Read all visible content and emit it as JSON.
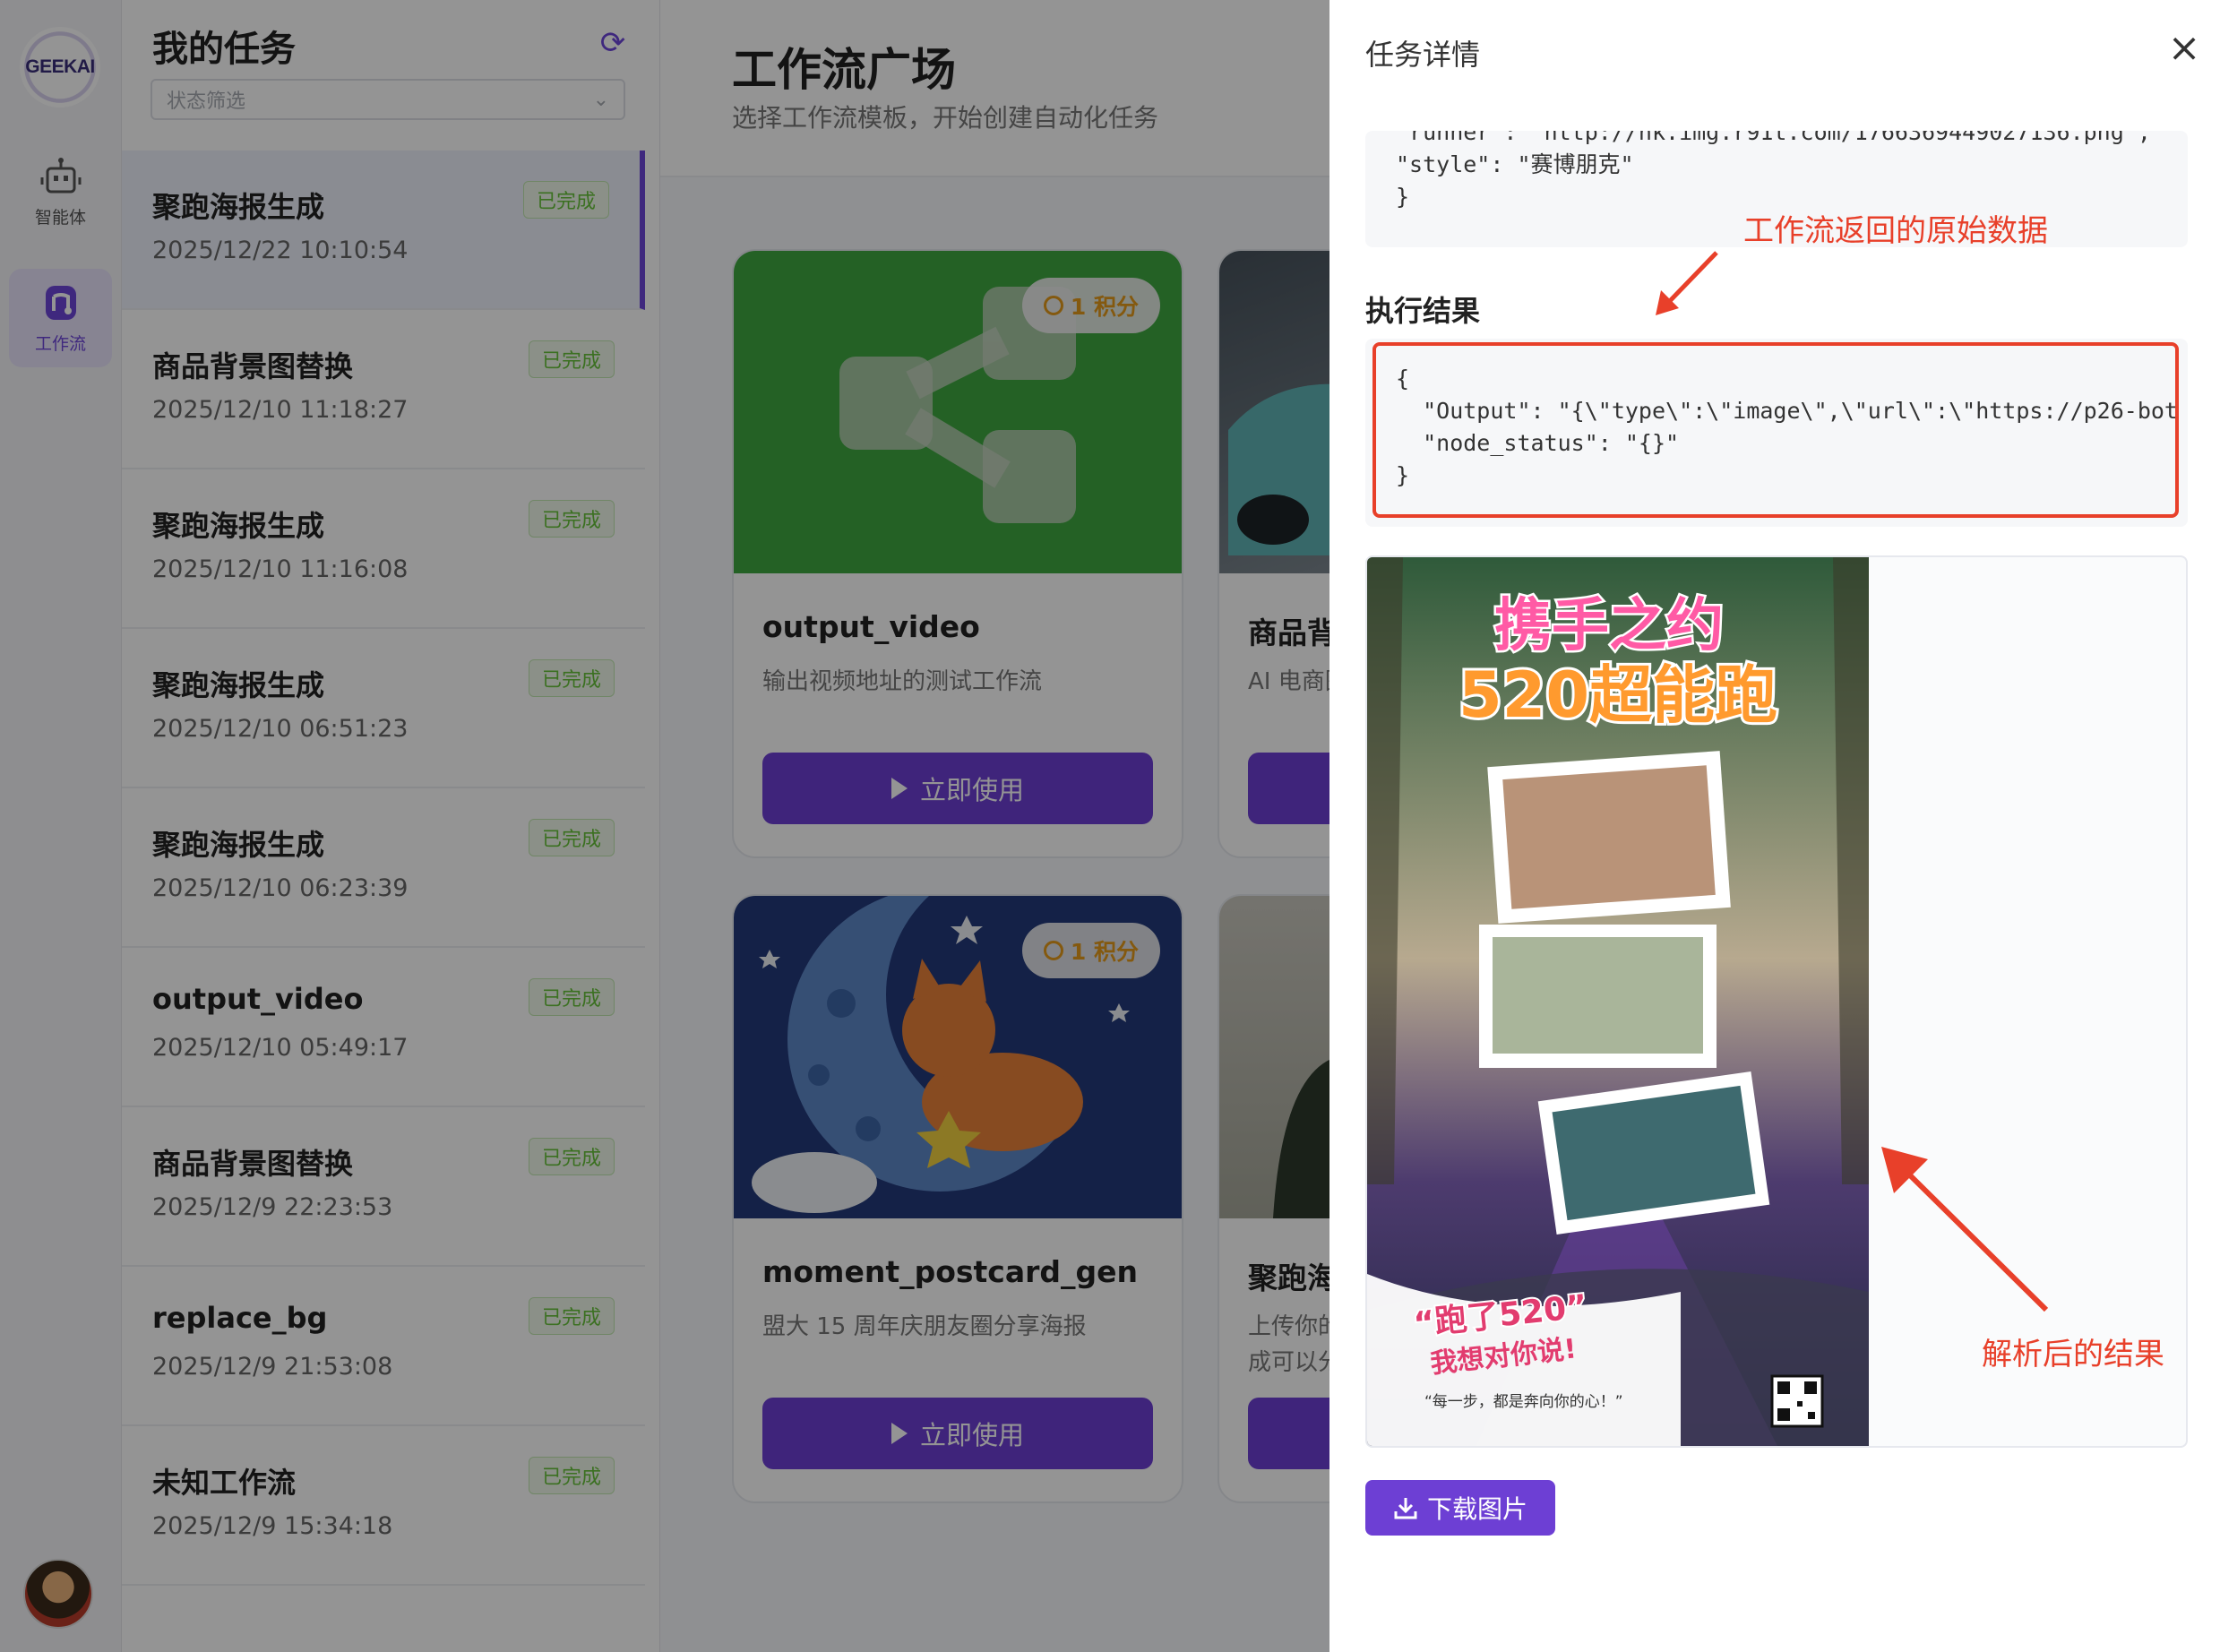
{
  "nav": {
    "logo_text": "GEEKAI",
    "items": [
      {
        "label": "智能体",
        "icon": "robot-icon"
      },
      {
        "label": "工作流",
        "icon": "workflow-icon"
      }
    ]
  },
  "tasks": {
    "title": "我的任务",
    "filter_placeholder": "状态筛选",
    "items": [
      {
        "name": "聚跑海报生成",
        "time": "2025/12/22 10:10:54",
        "status": "已完成"
      },
      {
        "name": "商品背景图替换",
        "time": "2025/12/10 11:18:27",
        "status": "已完成"
      },
      {
        "name": "聚跑海报生成",
        "time": "2025/12/10 11:16:08",
        "status": "已完成"
      },
      {
        "name": "聚跑海报生成",
        "time": "2025/12/10 06:51:23",
        "status": "已完成"
      },
      {
        "name": "聚跑海报生成",
        "time": "2025/12/10 06:23:39",
        "status": "已完成"
      },
      {
        "name": "output_video",
        "time": "2025/12/10 05:49:17",
        "status": "已完成"
      },
      {
        "name": "商品背景图替换",
        "time": "2025/12/9 22:23:53",
        "status": "已完成"
      },
      {
        "name": "replace_bg",
        "time": "2025/12/9 21:53:08",
        "status": "已完成"
      },
      {
        "name": "未知工作流",
        "time": "2025/12/9 15:34:18",
        "status": "已完成"
      }
    ]
  },
  "plaza": {
    "title": "工作流广场",
    "subtitle": "选择工作流模板，开始创建自动化任务",
    "cards": [
      {
        "title": "output_video",
        "desc": "输出视频地址的测试工作流",
        "cost": "1 积分",
        "button": "立即使用"
      },
      {
        "title": "商品背",
        "desc": "AI 电商图",
        "cost": "",
        "button": ""
      },
      {
        "title": "moment_postcard_gen",
        "desc": "盟大 15 周年庆朋友圈分享海报",
        "cost": "1 积分",
        "button": "立即使用"
      },
      {
        "title": "聚跑海",
        "desc": "上传你的",
        "desc2": "成可以分",
        "cost": "",
        "button": ""
      }
    ]
  },
  "drawer": {
    "title": "任务详情",
    "raw_lines": [
      "\"runner\": \"http://nk.img.r91t.com/1766369449027136.png\",",
      "\"style\": \"赛博朋克\"",
      "}"
    ],
    "annotation_raw": "工作流返回的原始数据",
    "result_title": "执行结果",
    "result_lines": [
      "{",
      "  \"Output\": \"{\\\"type\\\":\\\"image\\\",\\\"url\\\":\\\"https://p26-bot",
      "  \"node_status\": \"{}\"",
      "}"
    ],
    "annotation_parsed": "解析后的结果",
    "poster": {
      "title_line1": "携手之约",
      "title_line2": "520超能跑",
      "slogan_line1": "“跑了520”",
      "slogan_line2": "我想对你说!",
      "caption": "“每一步，都是奔向你的心！”"
    },
    "download_label": "下载图片"
  },
  "colors": {
    "accent": "#6d3fd4",
    "annotation": "#e8402a",
    "success": "#67c23a"
  }
}
